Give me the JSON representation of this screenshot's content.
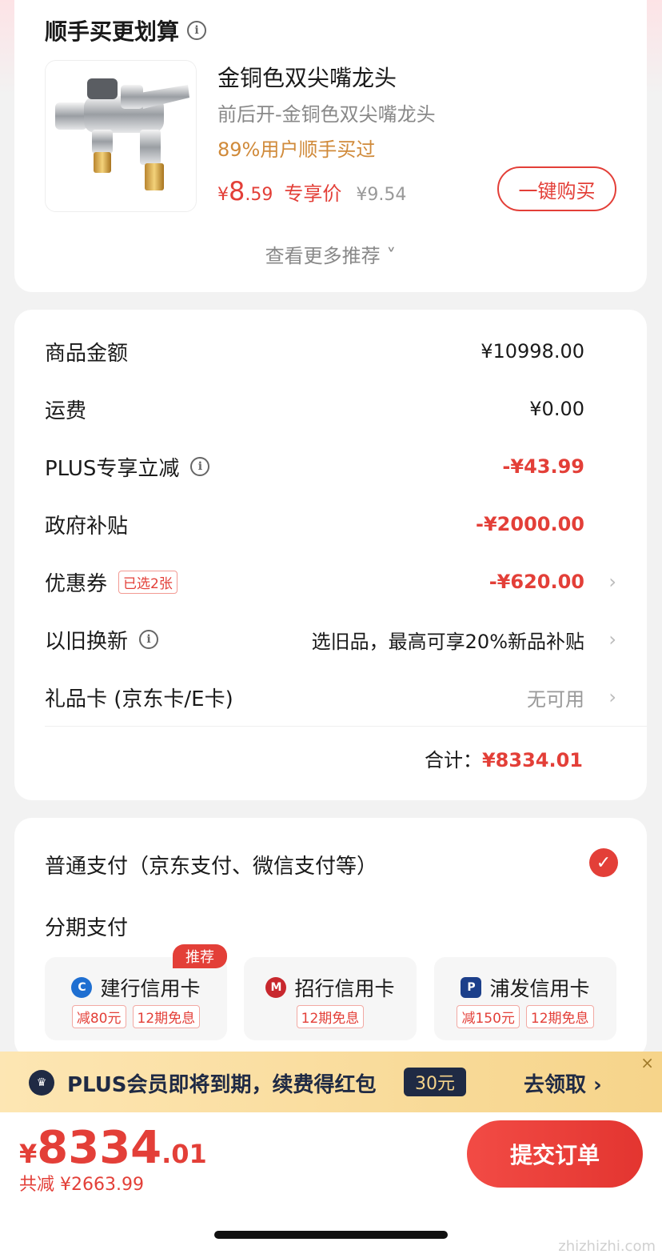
{
  "recommend": {
    "title": "顺手买更划算",
    "info_icon": "info-icon",
    "product": {
      "name": "金铜色双尖嘴龙头",
      "sub": "前后开-金铜色双尖嘴龙头",
      "users": "89%用户顺手买过",
      "price_currency": "¥",
      "price_int": "8",
      "price_dec": ".59",
      "price_tag": "专享价",
      "orig_price": "¥9.54",
      "buy_label": "一键购买"
    },
    "more_label": "查看更多推荐 ˅"
  },
  "summary": {
    "rows": [
      {
        "label": "商品金额",
        "value": "¥10998.00"
      },
      {
        "label": "运费",
        "value": "¥0.00"
      },
      {
        "label": "PLUS专享立减",
        "value": "-¥43.99"
      },
      {
        "label": "政府补贴",
        "value": "-¥2000.00"
      },
      {
        "label": "优惠券",
        "tag": "已选2张",
        "value": "-¥620.00"
      },
      {
        "label": "以旧换新",
        "value": "选旧品，最高可享20%新品补贴"
      },
      {
        "label": "礼品卡 (京东卡/E卡)",
        "value": "无可用"
      }
    ],
    "total_label": "合计：",
    "total_value": "¥8334.01",
    "chevron": "›"
  },
  "payment": {
    "normal_label": "普通支付（京东支付、微信支付等）",
    "installment_label": "分期支付",
    "recommend_badge": "推荐",
    "banks": [
      {
        "name": "建行信用卡",
        "tags": [
          "减80元",
          "12期免息"
        ]
      },
      {
        "name": "招行信用卡",
        "tags": [
          "12期免息"
        ]
      },
      {
        "name": "浦发信用卡",
        "tags": [
          "减150元",
          "12期免息"
        ]
      }
    ]
  },
  "plus_banner": {
    "text": "PLUS会员即将到期，续费得红包",
    "amount": "30元",
    "go_label": "去领取 ›",
    "close": "×"
  },
  "bottom_bar": {
    "currency": "¥",
    "price_int": "8334",
    "price_dec": ".01",
    "saved": "共减 ¥2663.99",
    "submit_label": "提交订单"
  },
  "watermark": "zhizhizhi.com",
  "colors": {
    "accent": "#e33f38",
    "gold": "#d08a3a",
    "plus_navy": "#1f2a44"
  }
}
